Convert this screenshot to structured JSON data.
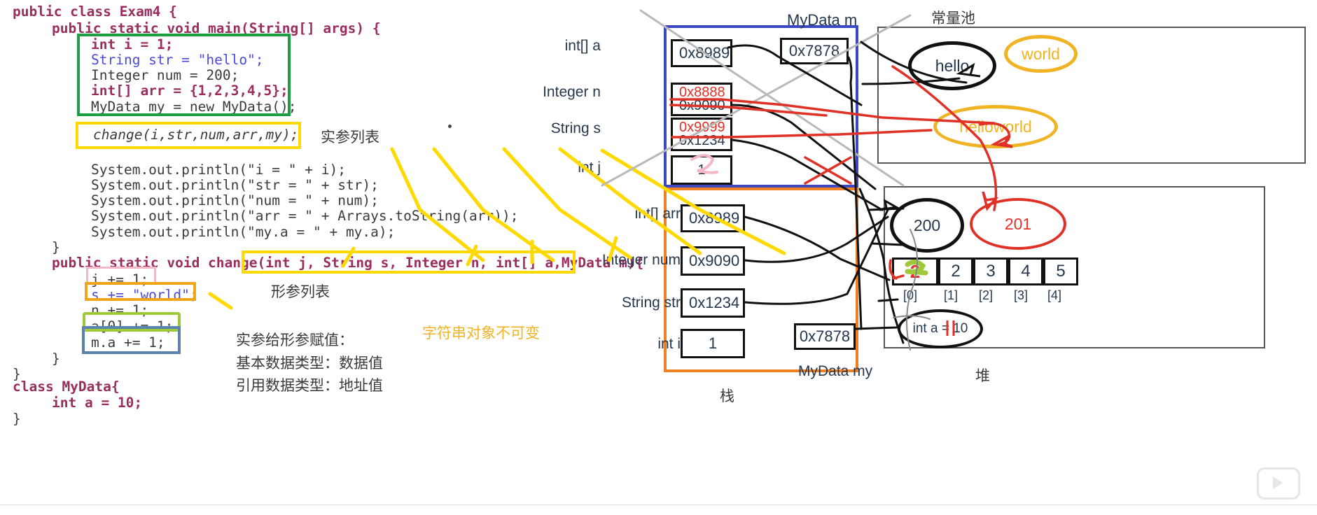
{
  "code": {
    "lines": [
      "public class Exam4 {",
      "    public static void main(String[] args) {",
      "        int i = 1;",
      "        String str = \"hello\";",
      "        Integer num = 200;",
      "        int[] arr = {1,2,3,4,5};",
      "        MyData my = new MyData();",
      "        change(i,str,num,arr,my);",
      "        System.out.println(\"i = \" + i);",
      "        System.out.println(\"str = \" + str);",
      "        System.out.println(\"num = \" + num);",
      "        System.out.println(\"arr = \" + Arrays.toString(arr));",
      "        System.out.println(\"my.a = \" + my.a);",
      "    }",
      "    public static void change(int j, String s, Integer n, int[] a,MyData m){",
      "        j += 1;",
      "        s += \"world\";",
      "        n += 1;",
      "        a[0] += 1;",
      "        m.a += 1;",
      "    }",
      "}",
      "class MyData{",
      "    int a = 10;",
      "}"
    ],
    "class_decl": "public class Exam4 {",
    "main_decl": "public static void main(String[] args) {",
    "decl_i": "int i = 1;",
    "decl_str": "String str = \"hello\";",
    "decl_num": "Integer num = 200;",
    "decl_arr": "int[] arr = {1,2,3,4,5};",
    "decl_my": "MyData my = new MyData();",
    "call_change": "change(i,str,num,arr,my);",
    "print_i": "System.out.println(\"i = \" + i);",
    "print_str": "System.out.println(\"str = \" + str);",
    "print_num": "System.out.println(\"num = \" + num);",
    "print_arr": "System.out.println(\"arr = \" + Arrays.toString(arr));",
    "print_mya": "System.out.println(\"my.a = \" + my.a);",
    "close_main": "}",
    "change_decl": "public static void change(int j, String s, Integer n, int[] a,MyData m){",
    "stmt_j": "j += 1;",
    "stmt_s": "s += \"world\";",
    "stmt_n": "n += 1;",
    "stmt_a0": "a[0] += 1;",
    "stmt_ma": "m.a += 1;",
    "close_change": "}",
    "close_class": "}",
    "mydata_decl": "class MyData{",
    "mydata_field": "int a = 10;",
    "mydata_close": "}"
  },
  "annotations": {
    "actual_params_label": "实参列表",
    "formal_params_label": "形参列表",
    "assign_title": "实参给形参赋值：",
    "assign_line1": "基本数据类型：数据值",
    "assign_line2": "引用数据类型：地址值",
    "string_immutable": "字符串对象不可变"
  },
  "diagram": {
    "labels": {
      "mydata_m": "MyData m",
      "constant_pool": "常量池",
      "mydata_my": "MyData my",
      "stack": "栈",
      "heap": "堆"
    },
    "frame_change": {
      "rows": [
        {
          "name": "int[]  a",
          "value": "0x8989"
        },
        {
          "name": "Integer n",
          "value": "0x8888",
          "old_value": "0x9090",
          "struck": true
        },
        {
          "name": "String  s",
          "value": "0x9999",
          "old_value": "0x1234",
          "struck": true
        },
        {
          "name": "int  j",
          "value": "1",
          "ink": "2"
        }
      ],
      "m_value": "0x7878"
    },
    "frame_main": {
      "rows": [
        {
          "name": "int[]    arr",
          "value": "0x8989"
        },
        {
          "name": "Integer num",
          "value": "0x9090"
        },
        {
          "name": "String str",
          "value": "0x1234"
        },
        {
          "name": "int  i",
          "value": "1"
        }
      ],
      "my_value": "0x7878"
    },
    "constant_pool": {
      "hello": "hello",
      "world": "world",
      "helloworld": "helloworld"
    },
    "heap": {
      "integer_200": "200",
      "integer_201": "201",
      "array_values": [
        "2",
        "2",
        "3",
        "4",
        "5"
      ],
      "array_ink_value": "2",
      "array_indices": [
        "[0]",
        "[1]",
        "[2]",
        "[3]",
        "[4]"
      ],
      "mydata_obj": "int a = 10",
      "mydata_ink": "11"
    }
  },
  "colors": {
    "green_box": "#1e9e43",
    "yellow_box": "#ffd900",
    "pink_box": "#f4b7c8",
    "orange_box": "#f0a519",
    "olive_box": "#9dc93b",
    "blue_box": "#5b83b0",
    "frame_blue": "#3b48c2",
    "frame_orange": "#f08021",
    "red_ink": "#e03127",
    "gold_text": "#f0b323"
  }
}
